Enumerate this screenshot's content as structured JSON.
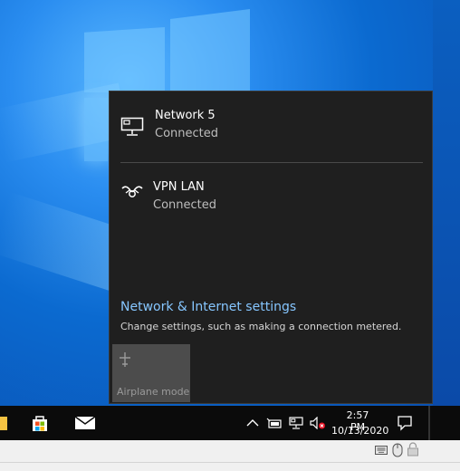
{
  "flyout": {
    "networks": [
      {
        "name": "Network 5",
        "status": "Connected",
        "icon": "ethernet-icon"
      },
      {
        "name": "VPN LAN",
        "status": "Connected",
        "icon": "vpn-icon"
      }
    ],
    "settings_link": "Network & Internet settings",
    "settings_desc": "Change settings, such as making a connection metered.",
    "airplane_label": "Airplane mode"
  },
  "taskbar": {
    "pinned": [
      {
        "icon": "file-explorer-icon"
      },
      {
        "icon": "microsoft-store-icon"
      },
      {
        "icon": "mail-icon"
      }
    ],
    "tray": [
      {
        "icon": "chevron-up-icon"
      },
      {
        "icon": "battery-plug-icon"
      },
      {
        "icon": "network-icon"
      },
      {
        "icon": "speaker-muted-icon"
      }
    ],
    "clock_time": "2:57 PM",
    "clock_date": "10/13/2020",
    "notification_icon": "action-center-icon"
  },
  "statusbar": {
    "icons": [
      "keyboard-icon",
      "mouse-icon",
      "lock-icon"
    ]
  },
  "colors": {
    "accent_link": "#86c6ff",
    "flyout_bg": "#1f1f1f",
    "taskbar_bg": "#0b0b0b",
    "airplane_tile": "#4c4c4c"
  }
}
